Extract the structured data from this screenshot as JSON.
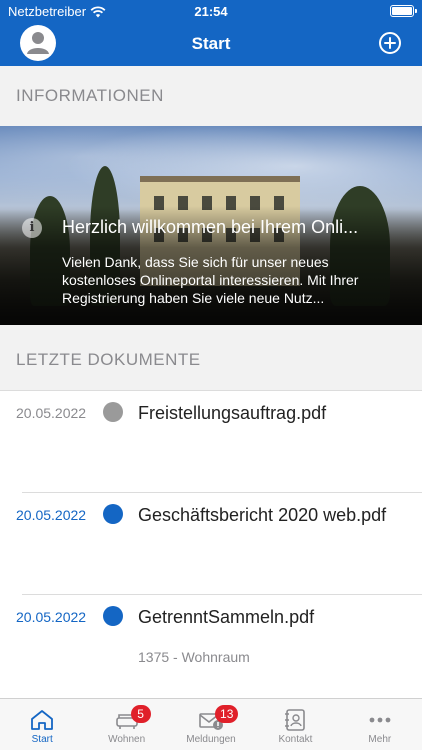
{
  "status_bar": {
    "carrier": "Netzbetreiber",
    "time": "21:54"
  },
  "header": {
    "title": "Start"
  },
  "sections": {
    "info_title": "INFORMATIONEN",
    "docs_title": "LETZTE DOKUMENTE"
  },
  "info_banner": {
    "title": "Herzlich willkommen bei Ihrem Onli...",
    "text": "Vielen Dank, dass Sie sich für unser neues kostenloses Onlineportal interessieren. Mit Ihrer Registrierung haben Sie viele neue Nutz..."
  },
  "documents": [
    {
      "date": "20.05.2022",
      "name": "Freistellungsauftrag.pdf",
      "sub": "",
      "status": "read"
    },
    {
      "date": "20.05.2022",
      "name": "Geschäftsbericht 2020 web.pdf",
      "sub": "",
      "status": "unread"
    },
    {
      "date": "20.05.2022",
      "name": "GetrenntSammeln.pdf",
      "sub": "1375 - Wohnraum",
      "status": "unread"
    }
  ],
  "tabs": [
    {
      "label": "Start",
      "icon": "home-icon",
      "active": true
    },
    {
      "label": "Wohnen",
      "icon": "sofa-icon",
      "badge": "5"
    },
    {
      "label": "Meldungen",
      "icon": "mail-alert-icon",
      "badge": "13"
    },
    {
      "label": "Kontakt",
      "icon": "contact-book-icon"
    },
    {
      "label": "Mehr",
      "icon": "more-icon"
    }
  ],
  "colors": {
    "primary": "#1466c4",
    "badge": "#e0202a",
    "read_dot": "#9a9a9a"
  }
}
